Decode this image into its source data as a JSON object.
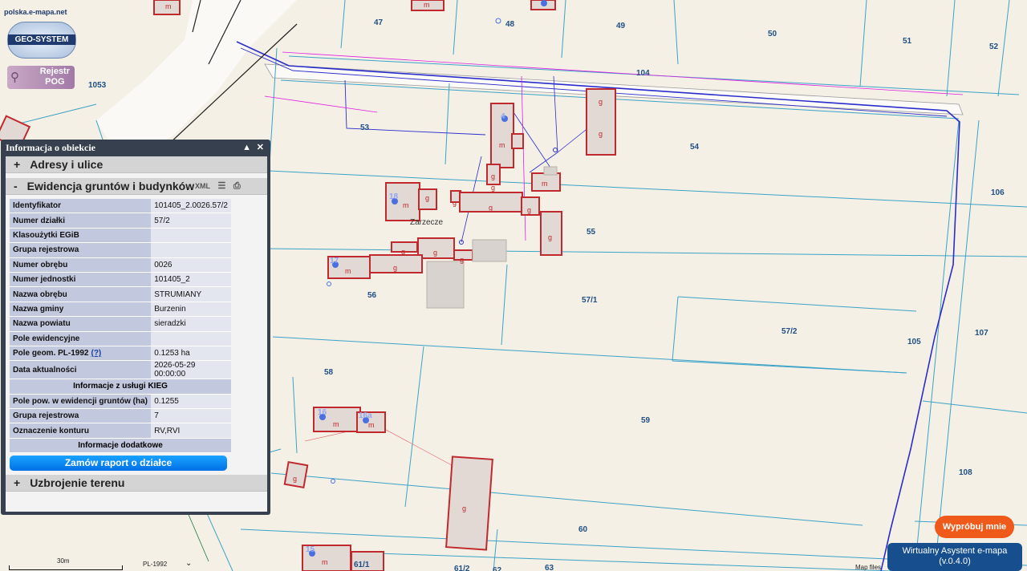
{
  "map": {
    "parcel_labels": [
      {
        "id": "p47",
        "text": "47"
      },
      {
        "id": "p48",
        "text": "48"
      },
      {
        "id": "p49",
        "text": "49"
      },
      {
        "id": "p50",
        "text": "50"
      },
      {
        "id": "p51",
        "text": "51"
      },
      {
        "id": "p52",
        "text": "52"
      },
      {
        "id": "p104",
        "text": "104"
      },
      {
        "id": "p1053",
        "text": "1053"
      },
      {
        "id": "p53",
        "text": "53"
      },
      {
        "id": "p54",
        "text": "54"
      },
      {
        "id": "p106",
        "text": "106"
      },
      {
        "id": "p55",
        "text": "55"
      },
      {
        "id": "p56",
        "text": "56"
      },
      {
        "id": "p571",
        "text": "57/1"
      },
      {
        "id": "p572",
        "text": "57/2"
      },
      {
        "id": "p105",
        "text": "105"
      },
      {
        "id": "p107",
        "text": "107"
      },
      {
        "id": "p58",
        "text": "58"
      },
      {
        "id": "p59",
        "text": "59"
      },
      {
        "id": "p108",
        "text": "108"
      },
      {
        "id": "p60",
        "text": "60"
      },
      {
        "id": "p611",
        "text": "61/1"
      },
      {
        "id": "p612",
        "text": "61/2"
      },
      {
        "id": "p62",
        "text": "62"
      },
      {
        "id": "p63",
        "text": "63"
      }
    ],
    "locality_label": "Zarzecze",
    "address_points": [
      "4",
      "18",
      "17",
      "16",
      "16a",
      "15"
    ],
    "building_codes": {
      "mieszkalny": "m",
      "gospodarczy": "g"
    }
  },
  "logo": {
    "site_url": "polska.e-mapa.net",
    "brand": "GEO-SYSTEM",
    "rejestr_line1": "Rejestr",
    "rejestr_line2": "POG"
  },
  "panel": {
    "title": "Informacja o obiekcie",
    "collapse_glyph": "▲",
    "close_glyph": "✕",
    "sections": {
      "adresy": {
        "toggle": "+",
        "label": "Adresy i ulice"
      },
      "egib": {
        "toggle": "-",
        "label": "Ewidencja gruntów i budynków",
        "xml_label": "XML"
      },
      "uzbrojenie": {
        "toggle": "+",
        "label": "Uzbrojenie terenu"
      }
    },
    "rows": [
      {
        "key": "Identyfikator",
        "value": "101405_2.0026.57/2"
      },
      {
        "key": "Numer działki",
        "value": "57/2"
      },
      {
        "key": "Klasoużytki EGiB",
        "value": ""
      },
      {
        "key": "Grupa rejestrowa",
        "value": ""
      },
      {
        "key": "Numer obrębu",
        "value": "0026"
      },
      {
        "key": "Numer jednostki",
        "value": "101405_2"
      },
      {
        "key": "Nazwa obrębu",
        "value": "STRUMIANY"
      },
      {
        "key": "Nazwa gminy",
        "value": "Burzenin"
      },
      {
        "key": "Nazwa powiatu",
        "value": "sieradzki"
      },
      {
        "key": "Pole ewidencyjne",
        "value": ""
      },
      {
        "key": "Pole geom. PL-1992",
        "help": "(?)",
        "value": "0.1253 ha"
      },
      {
        "key": "Data aktualności",
        "value": "2026-05-29 00:00:00"
      }
    ],
    "kieg_header": "Informacje z usługi KIEG",
    "kieg_rows": [
      {
        "key": "Pole pow. w ewidencji gruntów (ha)",
        "value": "0.1255"
      },
      {
        "key": "Grupa rejestrowa",
        "value": "7"
      },
      {
        "key": "Oznaczenie konturu",
        "value": "RV,RVI"
      }
    ],
    "extra_header": "Informacje dodatkowe",
    "report_button": "Zamów raport o działce"
  },
  "controls": {
    "scale_label": "30m",
    "crs_label": "PL-1992",
    "crs_dropdown": "⌄",
    "try_button": "Wypróbuj mnie",
    "assistant_line1": "Wirtualny Asystent e-mapa",
    "assistant_line2": "(v.0.4.0)",
    "map_files": "Map files"
  },
  "colors": {
    "map_background": "#f4f0e6",
    "parcel_line": "#3ba3c7",
    "building_fill": "#e2d8d4",
    "building_stroke": "#c0292d",
    "utility_blue": "#2a2ccc",
    "utility_magenta": "#e01ee0",
    "panel_frame": "#36404e",
    "report_button": "#0a85f0",
    "try_button": "#ef5a1a",
    "assistant_button": "#174f8e"
  }
}
